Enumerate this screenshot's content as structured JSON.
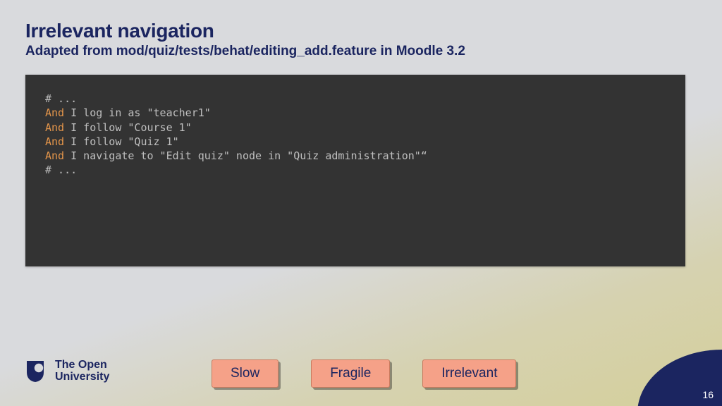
{
  "header": {
    "title": "Irrelevant navigation",
    "subtitle": "Adapted from mod/quiz/tests/behat/editing_add.feature in Moodle 3.2"
  },
  "code": {
    "lines": [
      {
        "prefix": "",
        "text": "# ..."
      },
      {
        "prefix": "",
        "text": ""
      },
      {
        "prefix": "And",
        "text": " I log in as \"teacher1\""
      },
      {
        "prefix": "And",
        "text": " I follow \"Course 1\""
      },
      {
        "prefix": "And",
        "text": " I follow \"Quiz 1\""
      },
      {
        "prefix": "And",
        "text": " I navigate to \"Edit quiz\" node in \"Quiz administration\"“"
      },
      {
        "prefix": "",
        "text": ""
      },
      {
        "prefix": "",
        "text": "# ..."
      }
    ]
  },
  "logo": {
    "line1": "The Open",
    "line2": "University"
  },
  "buttons": {
    "slow": "Slow",
    "fragile": "Fragile",
    "irrelevant": "Irrelevant"
  },
  "page_number": "16"
}
